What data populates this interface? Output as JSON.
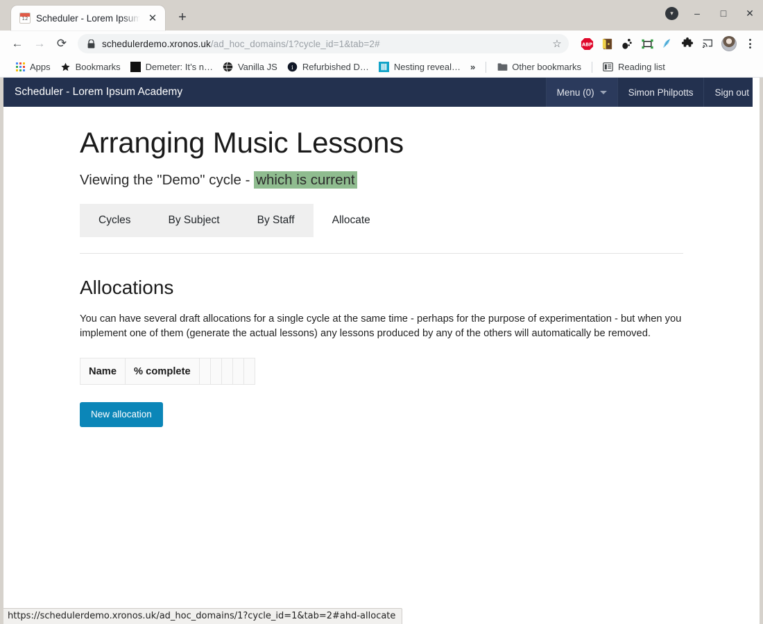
{
  "browser": {
    "tab": {
      "title": "Scheduler - Lorem Ipsum Academy",
      "favicon": "calendar-icon",
      "close_label": "✕"
    },
    "new_tab_label": "+",
    "window_controls": {
      "caret": "▾",
      "minimize": "–",
      "maximize": "□",
      "close": "✕"
    },
    "nav": {
      "back": "←",
      "forward": "→",
      "reload": "⟳"
    },
    "omnibox": {
      "lock_icon": "lock-icon",
      "url_domain": "schedulerdemo.xronos.uk",
      "url_path": "/ad_hoc_domains/1?cycle_id=1&tab=2#",
      "star_icon": "☆"
    },
    "extensions": [
      {
        "name": "adblock-plus-icon",
        "label": "ABP"
      },
      {
        "name": "keepass-icon",
        "label": ""
      },
      {
        "name": "gnome-icon",
        "label": ""
      },
      {
        "name": "screenshot-crop-icon",
        "label": ""
      },
      {
        "name": "feather-icon",
        "label": ""
      },
      {
        "name": "extensions-puzzle-icon",
        "label": ""
      },
      {
        "name": "cast-icon",
        "label": ""
      }
    ],
    "profile_avatar": "avatar",
    "chrome_menu": "kebab-menu-icon",
    "bookmarks": [
      {
        "name": "apps",
        "label": "Apps",
        "icon": "apps-grid-icon"
      },
      {
        "name": "bookmarks",
        "label": "Bookmarks",
        "icon": "star-icon"
      },
      {
        "name": "demeter",
        "label": "Demeter: It’s n…",
        "icon": "black-square-icon"
      },
      {
        "name": "vanilla-js",
        "label": "Vanilla JS",
        "icon": "globe-icon"
      },
      {
        "name": "refurbished",
        "label": "Refurbished D…",
        "icon": "info-circle-icon"
      },
      {
        "name": "nesting",
        "label": "Nesting reveal…",
        "icon": "document-icon"
      }
    ],
    "bookmarks_overflow": "»",
    "other_bookmarks": {
      "label": "Other bookmarks",
      "icon": "folder-icon"
    },
    "reading_list": {
      "label": "Reading list",
      "icon": "reading-list-icon"
    },
    "status_bar_url": "https://schedulerdemo.xronos.uk/ad_hoc_domains/1?cycle_id=1&tab=2#ahd-allocate"
  },
  "app": {
    "navbar": {
      "brand": "Scheduler - Lorem Ipsum Academy",
      "menu": {
        "label": "Menu (0)",
        "caret": "caret-down-icon"
      },
      "user": "Simon Philpotts",
      "sign_out": "Sign out",
      "background": "#23314f"
    },
    "page_title": "Arranging Music Lessons",
    "subtitle": {
      "prefix": "Viewing the \"Demo\" cycle - ",
      "badge": "which is current",
      "badge_color": "#8fbc8f"
    },
    "tabs": [
      {
        "label": "Cycles",
        "active": false
      },
      {
        "label": "By Subject",
        "active": false
      },
      {
        "label": "By Staff",
        "active": false
      },
      {
        "label": "Allocate",
        "active": true
      }
    ],
    "section": {
      "title": "Allocations",
      "description": "You can have several draft allocations for a single cycle at the same time - perhaps for the purpose of experimentation - but when you implement one of them (generate the actual lessons) any lessons produced by any of the others will automatically be removed."
    },
    "table": {
      "columns": [
        "Name",
        "% complete",
        "",
        "",
        "",
        "",
        ""
      ],
      "rows": []
    },
    "new_allocation_button": {
      "label": "New allocation",
      "color": "#0b86b8"
    }
  }
}
